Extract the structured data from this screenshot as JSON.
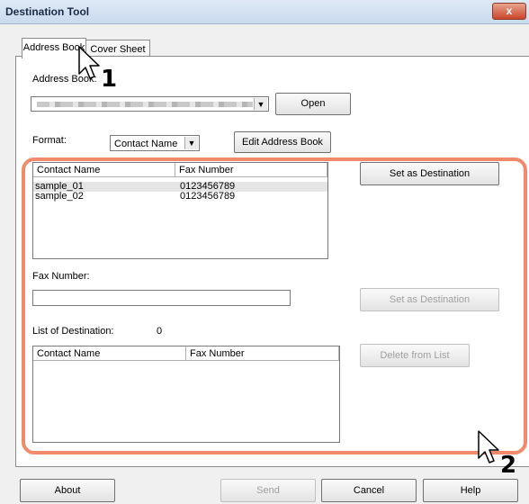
{
  "window": {
    "title": "Destination Tool",
    "close_label": "x"
  },
  "tabs": [
    {
      "label": "Address Book"
    },
    {
      "label": "Cover Sheet"
    }
  ],
  "address_book": {
    "label": "Address Book:",
    "selected": "",
    "open_label": "Open"
  },
  "format": {
    "label": "Format:",
    "selected": "Contact Name",
    "edit_label": "Edit Address Book"
  },
  "contacts": {
    "headers": [
      "Contact Name",
      "Fax Number"
    ],
    "rows": [
      {
        "name": "sample_01",
        "fax": "0123456789"
      },
      {
        "name": "sample_02",
        "fax": "0123456789"
      }
    ],
    "set_dest_label": "Set as Destination"
  },
  "fax": {
    "label": "Fax Number:",
    "value": "",
    "set_dest_label": "Set as Destination"
  },
  "destinations": {
    "label": "List of Destination:",
    "count": "0",
    "headers": [
      "Contact Name",
      "Fax Number"
    ],
    "delete_label": "Delete from List"
  },
  "footer": {
    "about": "About",
    "send": "Send",
    "cancel": "Cancel",
    "help": "Help"
  },
  "callouts": {
    "one": "1",
    "two": "2"
  },
  "colors": {
    "highlight": "#f08a6a",
    "selected_row": "#e5e5e5"
  }
}
